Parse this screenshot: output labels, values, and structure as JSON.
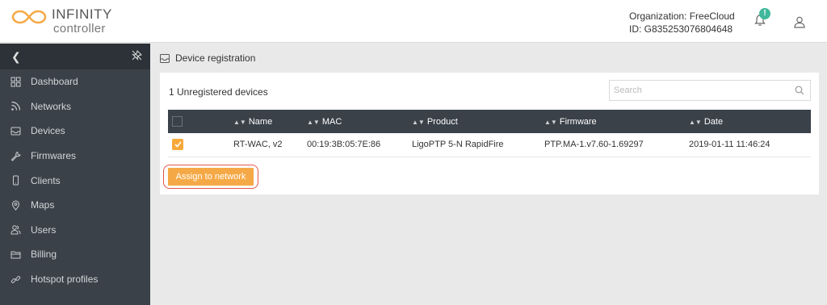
{
  "header": {
    "logo_title": "INFINITY",
    "logo_subtitle": "controller",
    "organization": "Organization: FreeCloud",
    "org_id": "ID: G835253076804648",
    "notification_badge": "!"
  },
  "sidebar": {
    "items": [
      {
        "label": "Dashboard",
        "icon": "dashboard-icon"
      },
      {
        "label": "Networks",
        "icon": "rss-icon"
      },
      {
        "label": "Devices",
        "icon": "inbox-icon"
      },
      {
        "label": "Firmwares",
        "icon": "wrench-icon"
      },
      {
        "label": "Clients",
        "icon": "phone-icon"
      },
      {
        "label": "Maps",
        "icon": "map-pin-icon"
      },
      {
        "label": "Users",
        "icon": "users-icon"
      },
      {
        "label": "Billing",
        "icon": "billing-icon"
      },
      {
        "label": "Hotspot profiles",
        "icon": "link-icon"
      }
    ]
  },
  "breadcrumb": {
    "label": "Device registration"
  },
  "panel": {
    "count_label": "1 Unregistered devices",
    "search_placeholder": "Search",
    "columns": [
      "Name",
      "MAC",
      "Product",
      "Firmware",
      "Date"
    ],
    "rows": [
      {
        "checked": true,
        "name": "RT-WAC, v2",
        "mac": "00:19:3B:05:7E:86",
        "product": "LigoPTP 5-N RapidFire",
        "firmware": "PTP.MA-1.v7.60-1.69297",
        "date": "2019-01-11 11:46:24"
      }
    ],
    "assign_label": "Assign to network"
  },
  "colors": {
    "accent": "#f5a946",
    "sidebar": "#3a4149",
    "badge": "#3fb89b",
    "highlight": "#e2574c"
  }
}
